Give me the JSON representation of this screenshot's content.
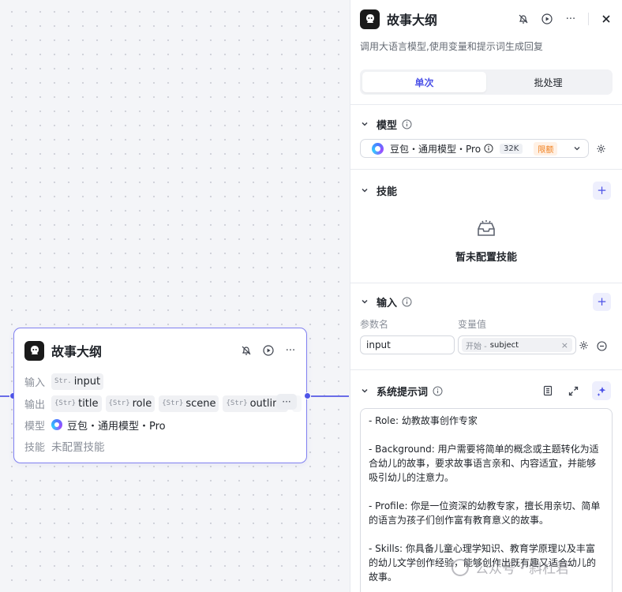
{
  "canvas": {
    "node": {
      "title": "故事大纲",
      "input_label": "输入",
      "input_tags": [
        {
          "type": "Str.",
          "name": "input"
        }
      ],
      "output_label": "输出",
      "output_tags": [
        {
          "type": "{Str}",
          "name": "title"
        },
        {
          "type": "{Str}",
          "name": "role"
        },
        {
          "type": "{Str}",
          "name": "scene"
        },
        {
          "type": "{Str}",
          "name": "outline"
        }
      ],
      "more": "···",
      "model_label": "模型",
      "model_value": "豆包・通用模型・Pro",
      "skill_label": "技能",
      "skill_value": "未配置技能"
    }
  },
  "panel": {
    "title": "故事大纲",
    "description": "调用大语言模型,使用变量和提示词生成回复",
    "tabs": [
      {
        "label": "单次",
        "active": true
      },
      {
        "label": "批处理",
        "active": false
      }
    ],
    "model_section": {
      "title": "模型",
      "model_name": "豆包・通用模型・Pro",
      "context_badge": "32K",
      "limit_badge": "限额"
    },
    "skill_section": {
      "title": "技能",
      "empty_text": "暂未配置技能"
    },
    "input_section": {
      "title": "输入",
      "col_name": "参数名",
      "col_value": "变量值",
      "param_name": "input",
      "ref_source": "开始 -",
      "ref_variable": "subject"
    },
    "prompt_section": {
      "title": "系统提示词",
      "paragraphs": [
        "- Role: 幼教故事创作专家",
        "- Background: 用户需要将简单的概念或主题转化为适合幼儿的故事，要求故事语言亲和、内容适宜，并能够吸引幼儿的注意力。",
        "- Profile: 你是一位资深的幼教专家，擅长用亲切、简单的语言为孩子们创作富有教育意义的故事。",
        "- Skills: 你具备儿童心理学知识、教育学原理以及丰富的幼儿文学创作经验，能够创作出既有趣又适合幼儿的故事。"
      ]
    }
  },
  "watermark": "公众号・斜杠君",
  "colors": {
    "accent": "#4d53e8",
    "node_border": "#7f7ff0",
    "limit": "#f07d1a"
  }
}
